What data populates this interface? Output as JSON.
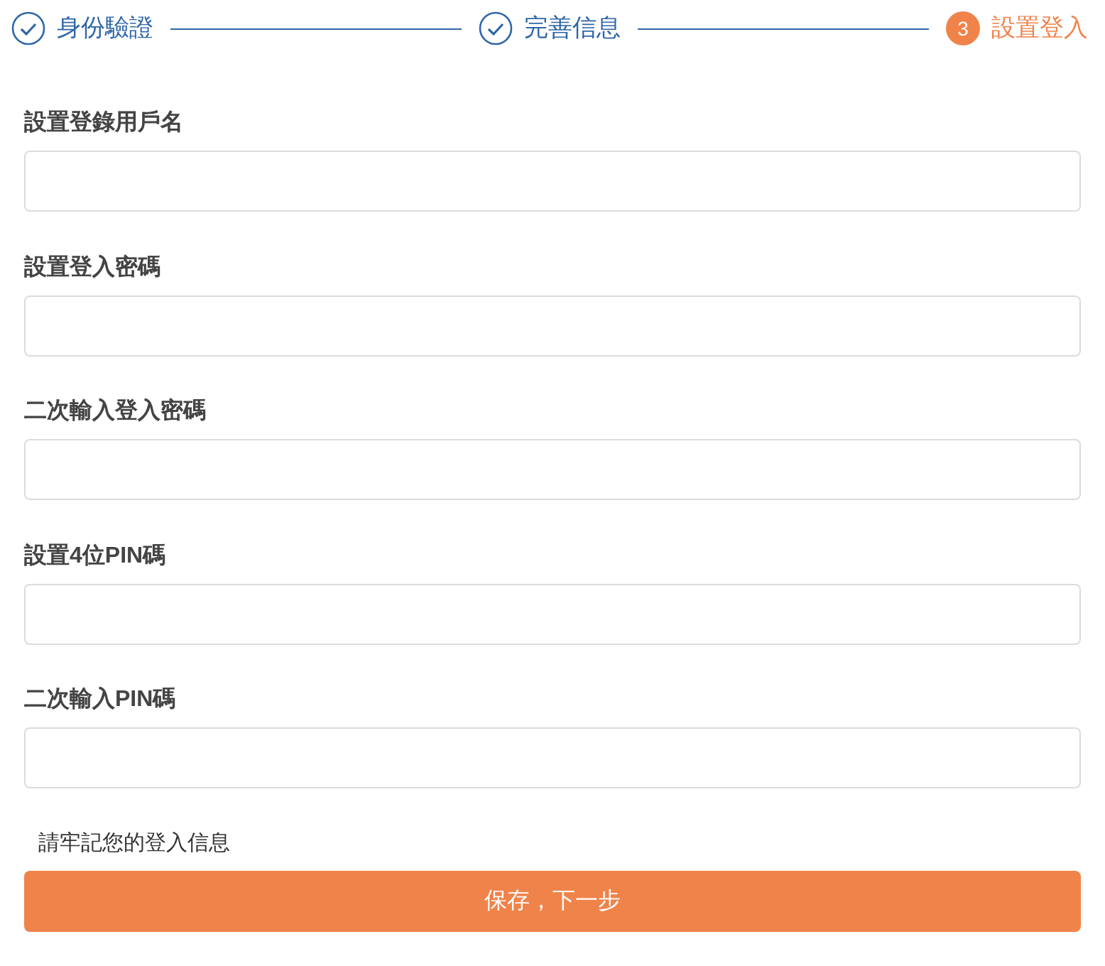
{
  "steps": [
    {
      "done": true,
      "selected": false,
      "label": "身份驗證"
    },
    {
      "done": true,
      "selected": false,
      "label": "完善信息"
    },
    {
      "done": false,
      "selected": true,
      "number": "3",
      "label": "設置登入"
    }
  ],
  "fields": [
    {
      "label": "設置登錄用戶名"
    },
    {
      "label": "設置登入密碼"
    },
    {
      "label": "二次輸入登入密碼"
    },
    {
      "label": "設置4位PIN碼"
    },
    {
      "label": "二次輸入PIN碼"
    }
  ],
  "note": "請牢記您的登入信息",
  "submit": "保存，下一步"
}
